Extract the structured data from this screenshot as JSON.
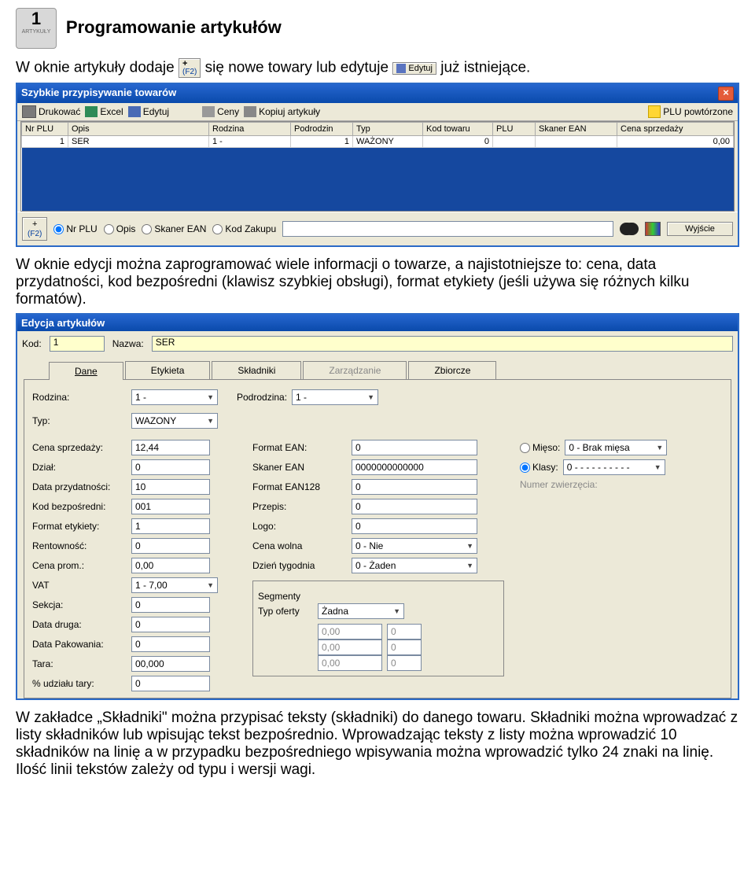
{
  "icon_block": {
    "number": "1",
    "label": "ARTYKUŁY"
  },
  "heading": "Programowanie artykułów",
  "para1_a": "W oknie artykuły dodaje",
  "para1_b": "się nowe towary lub edytuje",
  "para1_c": "już istniejące.",
  "plus_btn": {
    "plus": "+",
    "f2": "(F2)"
  },
  "edit_btn_label": "Edytuj",
  "win1": {
    "title": "Szybkie przypisywanie towarów",
    "tools": {
      "print": "Drukować",
      "excel": "Excel",
      "edit": "Edytuj",
      "ceny": "Ceny",
      "kopiuj": "Kopiuj artykuły",
      "plu_rep": "PLU powtórzone"
    },
    "cols": [
      "Nr PLU",
      "Opis",
      "Rodzina",
      "Podrodzin",
      "Typ",
      "Kod towaru",
      "PLU",
      "Skaner EAN",
      "Cena sprzedaży"
    ],
    "row": {
      "plu": "1",
      "opis": "SER",
      "rodzina": "1 -",
      "podrodzin": "1",
      "typ": "WAŻONY",
      "kod": "0",
      "plu2": "",
      "ean": "",
      "cena": "0,00"
    },
    "filter": {
      "plus": "+",
      "f2": "(F2)",
      "r1": "Nr PLU",
      "r2": "Opis",
      "r3": "Skaner EAN",
      "r4": "Kod Zakupu",
      "exit": "Wyjście"
    }
  },
  "para2": "W oknie edycji można zaprogramować wiele informacji o towarze, a najistotniejsze to: cena, data przydatności, kod bezpośredni (klawisz szybkiej obsługi), format etykiety (jeśli używa się różnych kilku formatów).",
  "win2": {
    "title": "Edycja artykułów",
    "kod_label": "Kod:",
    "kod_val": "1",
    "nazwa_label": "Nazwa:",
    "nazwa_val": "SER",
    "tabs": {
      "dane": "Dane",
      "etykieta": "Etykieta",
      "skladniki": "Składniki",
      "zarz": "Zarządzanie",
      "zbiorcze": "Zbiorcze"
    },
    "top": {
      "rodzina_l": "Rodzina:",
      "rodzina_v": "1 -",
      "podrodzina_l": "Podrodzina:",
      "podrodzina_v": "1 -",
      "typ_l": "Typ:",
      "typ_v": "WAZONY"
    },
    "left": {
      "cena_l": "Cena sprzedaży:",
      "cena_v": "12,44",
      "dzial_l": "Dział:",
      "dzial_v": "0",
      "data_l": "Data przydatności:",
      "data_v": "10",
      "kodb_l": "Kod bezpośredni:",
      "kodb_v": "001",
      "fmt_l": "Format etykiety:",
      "fmt_v": "1",
      "rent_l": "Rentowność:",
      "rent_v": "0",
      "prom_l": "Cena prom.:",
      "prom_v": "0,00",
      "vat_l": "VAT",
      "vat_v": "1 - 7,00",
      "sek_l": "Sekcja:",
      "sek_v": "0",
      "datad_l": "Data druga:",
      "datad_v": "0",
      "datap_l": "Data Pakowania:",
      "datap_v": "0",
      "tara_l": "Tara:",
      "tara_v": "00,000",
      "udz_l": "% udziału tary:",
      "udz_v": "0"
    },
    "mid": {
      "fean_l": "Format EAN:",
      "fean_v": "0",
      "sean_l": "Skaner EAN",
      "sean_v": "0000000000000",
      "f128_l": "Format EAN128",
      "f128_v": "0",
      "prz_l": "Przepis:",
      "prz_v": "0",
      "logo_l": "Logo:",
      "logo_v": "0",
      "cw_l": "Cena wolna",
      "cw_v": "0 - Nie",
      "dt_l": "Dzień tygodnia",
      "dt_v": "0 - Żaden",
      "seg_h": "Segmenty",
      "to_l": "Typ oferty",
      "to_v": "Żadna",
      "p1a": "0,00",
      "p1b": "0",
      "p2a": "0,00",
      "p2b": "0",
      "p3a": "0,00",
      "p3b": "0"
    },
    "right": {
      "mieso_l": "Mięso:",
      "mieso_v": "0 - Brak mięsa",
      "klasy_l": "Klasy:",
      "klasy_v": "0 - - - - - - - - - -",
      "nz_l": "Numer zwierzęcia:"
    }
  },
  "para3": "W zakładce „Składniki\" można przypisać teksty (składniki) do danego towaru. Składniki można wprowadzać z listy składników lub wpisując tekst bezpośrednio. Wprowadzając teksty z listy można wprowadzić 10 składników na linię a w przypadku bezpośredniego wpisywania można wprowadzić tylko 24 znaki na linię. Ilość linii tekstów zależy od typu i wersji wagi."
}
